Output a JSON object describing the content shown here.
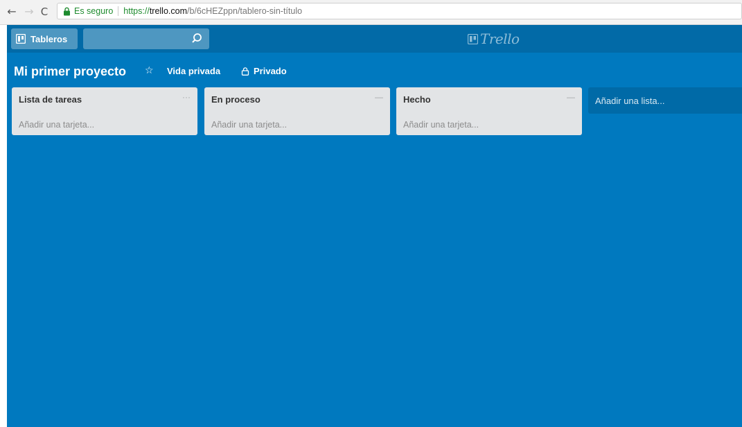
{
  "browser": {
    "back_glyph": "←",
    "forward_glyph": "→",
    "reload_glyph": "C",
    "secure_label": "Es seguro",
    "url_scheme": "https://",
    "url_host": "trello.com",
    "url_path": "/b/6cHEZppn/tablero-sin-título"
  },
  "header": {
    "boards_label": "Tableros",
    "search_value": "",
    "logo_text": "Trello"
  },
  "board": {
    "title": "Mi primer proyecto",
    "star_glyph": "☆",
    "visibility_team": "Vida privada",
    "privacy_label": "Privado"
  },
  "lists": [
    {
      "title": "Lista de tareas",
      "menu": "···",
      "add_card": "Añadir una tarjeta..."
    },
    {
      "title": "En proceso",
      "menu": "—",
      "add_card": "Añadir una tarjeta..."
    },
    {
      "title": "Hecho",
      "menu": "—",
      "add_card": "Añadir una tarjeta..."
    }
  ],
  "add_list_label": "Añadir una lista...",
  "colors": {
    "board_background": "#0079bf",
    "header_background": "#026aa7",
    "list_background": "#e2e4e6",
    "secure_green": "#1e8b2e"
  }
}
